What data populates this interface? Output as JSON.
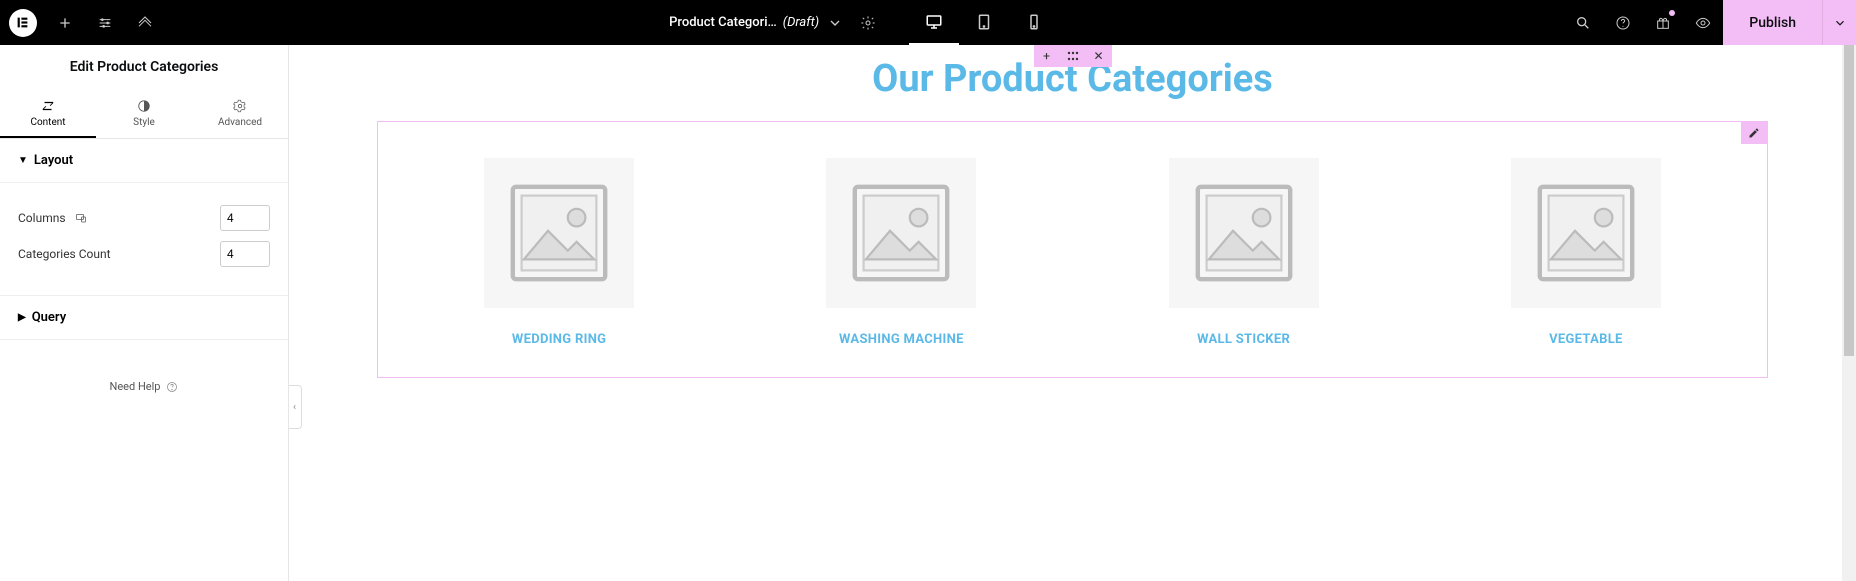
{
  "header": {
    "doc_title": "Product Categori…",
    "doc_status": "(Draft)",
    "publish_label": "Publish"
  },
  "sidebar": {
    "title": "Edit Product Categories",
    "tabs": {
      "content": "Content",
      "style": "Style",
      "advanced": "Advanced"
    },
    "sections": {
      "layout": {
        "title": "Layout",
        "columns_label": "Columns",
        "columns_value": "4",
        "count_label": "Categories Count",
        "count_value": "4"
      },
      "query": {
        "title": "Query"
      }
    },
    "help_label": "Need Help"
  },
  "canvas": {
    "hero_title": "Our Product Categories",
    "categories": [
      {
        "name": "WEDDING RING"
      },
      {
        "name": "WASHING MACHINE"
      },
      {
        "name": "WALL STICKER"
      },
      {
        "name": "VEGETABLE"
      }
    ]
  },
  "colors": {
    "accent": "#5bb9e8",
    "selection": "#f3bdf5"
  }
}
